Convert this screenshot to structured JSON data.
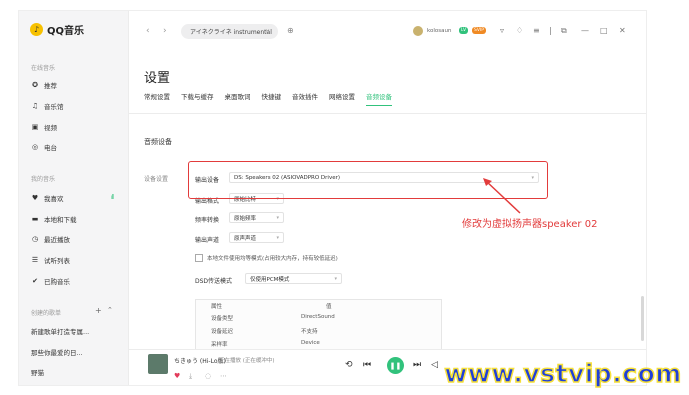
{
  "app": {
    "logo_text": "QQ音乐"
  },
  "sidebar": {
    "online_title": "在线音乐",
    "online_items": [
      {
        "label": "推荐",
        "icon": "disc-icon"
      },
      {
        "label": "音乐馆",
        "icon": "note-icon"
      },
      {
        "label": "视频",
        "icon": "video-icon"
      },
      {
        "label": "电台",
        "icon": "radio-icon"
      }
    ],
    "mine_title": "我的音乐",
    "mine_items": [
      {
        "label": "我喜欢",
        "icon": "heart-icon"
      },
      {
        "label": "本地和下载",
        "icon": "monitor-icon"
      },
      {
        "label": "最近播放",
        "icon": "clock-icon"
      },
      {
        "label": "试听列表",
        "icon": "list-icon"
      },
      {
        "label": "已购音乐",
        "icon": "check-circle-icon"
      }
    ],
    "playlist_title": "创建的歌单",
    "playlists": [
      "新建歌单打造专属...",
      "那些你最爱的日...",
      "野猫"
    ]
  },
  "topbar": {
    "search_value": "アイネクライネ instrumental",
    "username": "kolosaun",
    "badge1": "LV",
    "badge2": "SVIP"
  },
  "settings": {
    "title": "设置",
    "tabs": [
      "常规设置",
      "下载与缓存",
      "桌面歌词",
      "快捷键",
      "音效插件",
      "网络设置",
      "音频设备"
    ],
    "active_tab_index": 6,
    "subheading": "音频设备",
    "device_section_label": "设备设置",
    "rows": [
      {
        "label": "输出设备",
        "value": "DS: Speakers 02 (ASIOVADPRO Driver)"
      },
      {
        "label": "输出格式",
        "value": "原始比特"
      },
      {
        "label": "频率转换",
        "value": "原始频率"
      },
      {
        "label": "输出声道",
        "value": "原声声道"
      }
    ],
    "checkbox_label": "本地文件使用均等模式(占用较大内存，持有较低延迟)",
    "dsd_label": "DSD传送模式",
    "dsd_value": "仅使用PCM模式",
    "table_headers": [
      "属性",
      "值"
    ],
    "table_rows": [
      {
        "k": "设备类型",
        "v": "DirectSound"
      },
      {
        "k": "设备延迟",
        "v": "不支持"
      },
      {
        "k": "采样率",
        "v": "Device"
      }
    ]
  },
  "player": {
    "song": "ちきゅう (Hi-Lo版)",
    "status": "正在播放 (正在缓冲中)"
  },
  "annotation": "修改为虚拟扬声器speaker 02",
  "watermark": "www.vstvip.com",
  "colors": {
    "accent": "#31c27c",
    "highlight": "#e23b3b",
    "watermark": "#1f3fd8"
  }
}
